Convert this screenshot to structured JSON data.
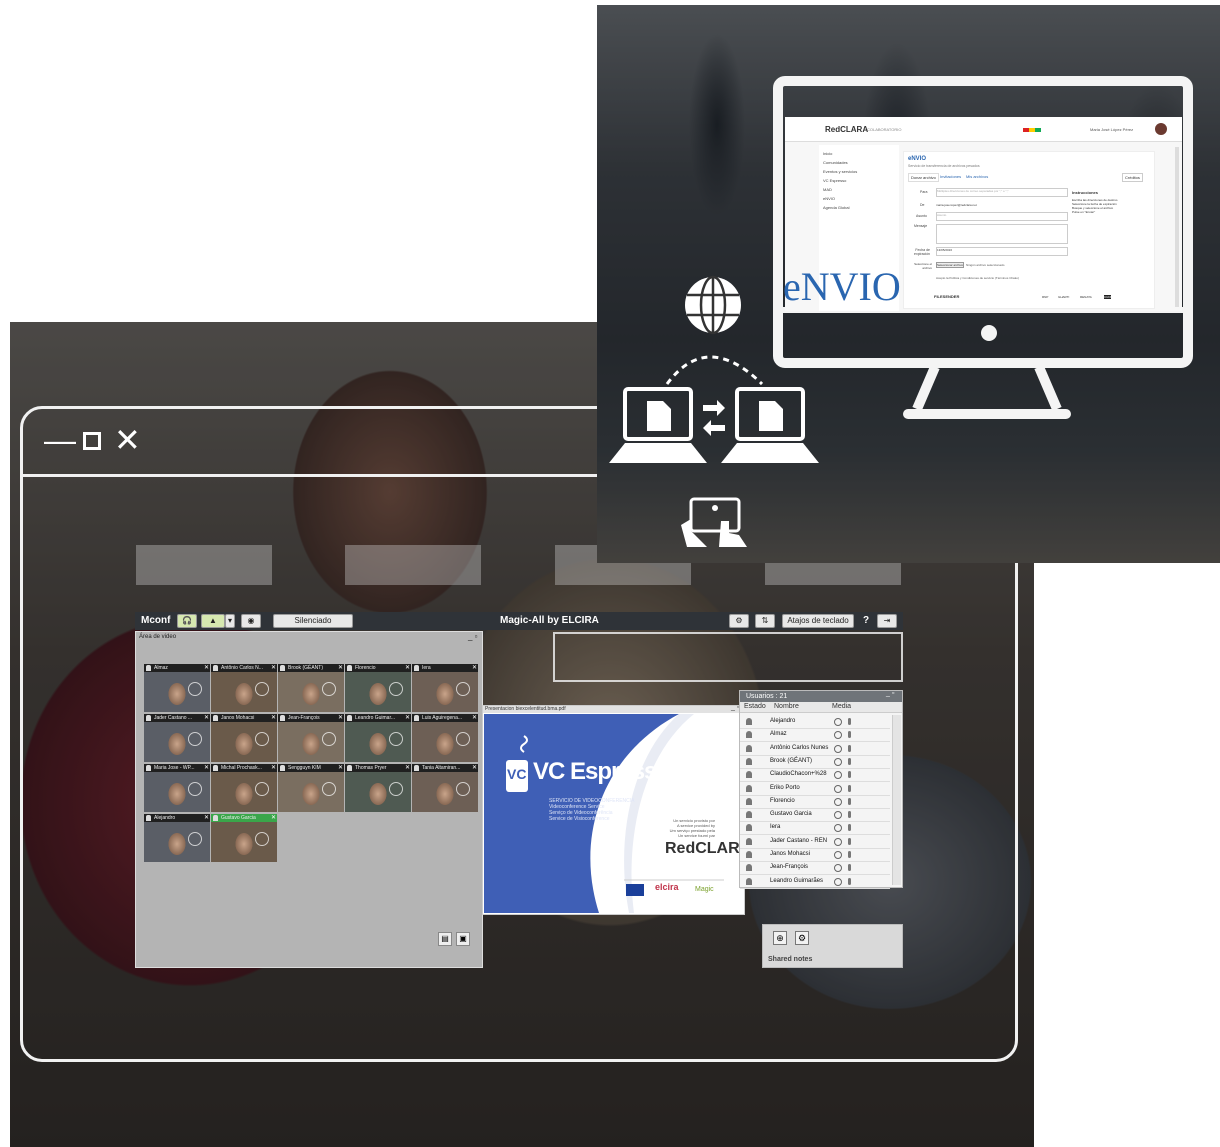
{
  "mconf": {
    "logo": "Mconf",
    "mute_label": "Silenciado",
    "title": "Magic-All by ELCIRA",
    "shortcuts_label": "Atajos de teclado",
    "help_label": "?",
    "video_area_title": "Área de video",
    "video_tiles": [
      {
        "name": "Almaz"
      },
      {
        "name": "Antônio Carlos N..."
      },
      {
        "name": "Brook (GÉANT)"
      },
      {
        "name": "Florencio"
      },
      {
        "name": "Iera"
      },
      {
        "name": "Jader Castano ..."
      },
      {
        "name": "Janos Mohacsi"
      },
      {
        "name": "Jean-François"
      },
      {
        "name": "Leandro Guimar..."
      },
      {
        "name": "Luis Aguiregena..."
      },
      {
        "name": "Maria Jose - WP..."
      },
      {
        "name": "Michal Prochask..."
      },
      {
        "name": "Sengguyn KIM"
      },
      {
        "name": "Thomas Pryer"
      },
      {
        "name": "Tania Altamiran..."
      },
      {
        "name": "Alejandro"
      },
      {
        "name": "Gustavo Garcia"
      }
    ],
    "presentation_title": "Presentacion biexcelentitud.bma.pdf",
    "presentation": {
      "brand": "VC Espresso",
      "subtitle_lines": [
        "SERVICIO DE VIDEOCONFERENCIA",
        "Videoconference Service",
        "Serviço de Videoconferência",
        "Service de Visioconférence"
      ],
      "provided_lines": [
        "Un servicio provisto por",
        "A service provided by",
        "Um serviço prestado pela",
        "Un service fourni par"
      ],
      "org": "RedCLARA",
      "partner_logos": [
        "elcira",
        "Magic"
      ]
    },
    "users_title": "Usuarios : 21",
    "users_columns": [
      "Estado",
      "Nombre",
      "Media"
    ],
    "users": [
      "Alejandro",
      "Almaz",
      "Antônio Carlos Nunes",
      "Brook (GÉANT)",
      "ClaudioChacon+%28",
      "Eriko Porto",
      "Florencio",
      "Gustavo Garcia",
      "Iera",
      "Jader Castano - REN",
      "Janos Mohacsi",
      "Jean-François",
      "Leandro Guimarães"
    ],
    "notes_title": "Shared notes"
  },
  "envio": {
    "brand": "eNVIO",
    "app_name": "eNVIO",
    "subtitle": "Servicio de transferencia de archivos pesados",
    "tabs": [
      "Donar archivo",
      "Invitaciones",
      "Mis archivos"
    ],
    "credits_button": "Créditos",
    "sidebar": [
      "Inicio",
      "Comunidades",
      "Eventos y servicios",
      "VC Espresso",
      "MAD",
      "eNVIO",
      "Agenda Global"
    ],
    "form_labels": [
      "Para",
      "De",
      "Asunto",
      "Mensaje",
      "Fecha de expiración",
      "Seleccione el archivo"
    ],
    "to_placeholder": "Múltiples direcciones de correo separadas por \",\" o \";\"",
    "from_value": "maria.jose.lopez@redclara.net",
    "subject_placeholder": "Asunto",
    "expiry_value": "13/05/2016",
    "file_button": "Seleccionar archivo",
    "file_status": "Ningún archivo seleccionado",
    "terms_text": "Acepto la Política y Condiciones de servicio (Términos Chako)",
    "instructions_title": "Instrucciones",
    "instructions": [
      "Escriba las direcciones de destino",
      "Seleccione la fecha de expiración",
      "Busque y seleccione el archivo",
      "Pulse en \"Enviar\""
    ],
    "header_brand": "RedCLARA",
    "header_section": "COLABORATORIO",
    "header_user": "Maria José López Pérez",
    "footer_logos": [
      "FILESENDER",
      "RNP",
      "GHARTI",
      "RENATA",
      "CUDI"
    ]
  },
  "window": {
    "controls": [
      "—",
      "☐",
      "✕"
    ]
  }
}
